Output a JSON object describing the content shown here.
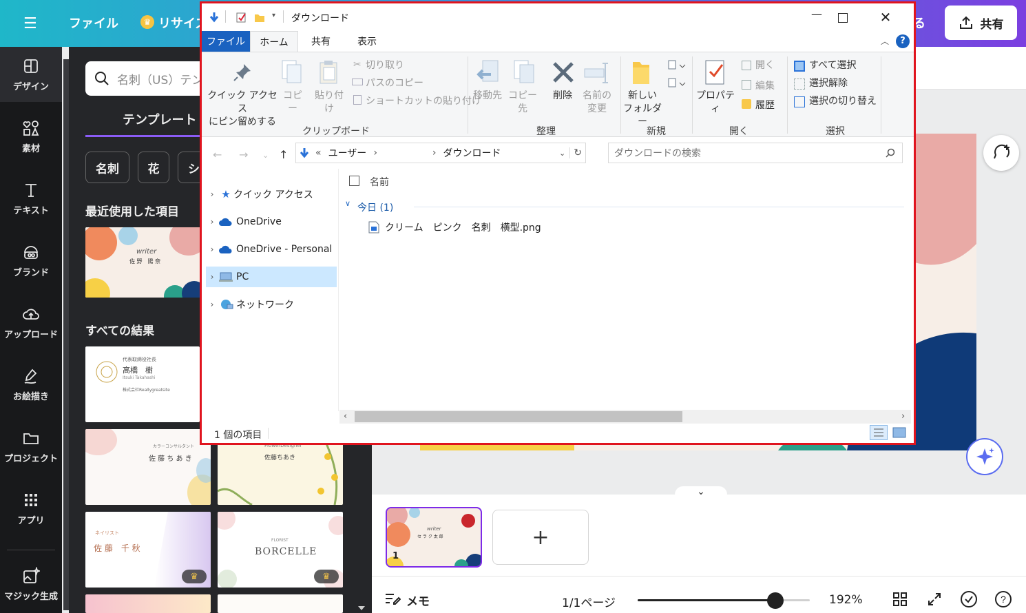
{
  "header": {
    "file_menu": "ファイル",
    "resize": "リサイズ",
    "share": "共有",
    "partial_right": "る"
  },
  "rail": {
    "items": [
      {
        "label": "デザイン"
      },
      {
        "label": "素材"
      },
      {
        "label": "テキスト"
      },
      {
        "label": "ブランド"
      },
      {
        "label": "アップロード"
      },
      {
        "label": "お絵描き"
      },
      {
        "label": "プロジェクト"
      },
      {
        "label": "アプリ"
      },
      {
        "label": "マジック生成"
      }
    ]
  },
  "panel": {
    "search_placeholder": "名刺（US）テン",
    "template_tab": "テンプレート",
    "chips": [
      "名刺",
      "花",
      "シ"
    ],
    "recent_title": "最近使用した項目",
    "all_results_title": "すべての結果",
    "cards": [
      {
        "name": "高橋　樹",
        "sub": "Itsuki Takahashi",
        "company": "株式会社Reallygreatsite",
        "role": "代表取締役社長"
      },
      {
        "name": "佐 藤 ち あ き",
        "role": "カラーコンサルタント"
      },
      {
        "name": "佐藤ちあき",
        "role": "FlowerDesigner"
      },
      {
        "name": "佐 藤　千 秋",
        "role": "ネイリスト"
      },
      {
        "name": "BORCELLE",
        "role": "FLORIST"
      }
    ],
    "recent_card": {
      "script": "writer",
      "name": "佐 野　陽 奈"
    },
    "crown": "♛"
  },
  "editor": {
    "page_label": "1",
    "add_page": "+",
    "memo": "メモ",
    "page_indicator": "1/1ページ",
    "zoom": "192%",
    "zoom_fraction": 0.8,
    "thumb_script": "writer",
    "thumb_name": "セ ラ ク 太 郎"
  },
  "explorer": {
    "title": "ダウンロード",
    "tabs": {
      "file": "ファイル",
      "home": "ホーム",
      "share": "共有",
      "view": "表示"
    },
    "ribbon": {
      "pin": "クイック アクセス\nにピン留めする",
      "copy": "コピー",
      "paste": "貼り付け",
      "cut": "切り取り",
      "copy_path": "パスのコピー",
      "paste_shortcut": "ショートカットの貼り付け",
      "clipboard": "クリップボード",
      "move_to": "移動先",
      "copy_to": "コピー先",
      "delete": "削除",
      "rename": "名前の\n変更",
      "organize": "整理",
      "new_folder": "新しい\nフォルダー",
      "new": "新規",
      "properties": "プロパティ",
      "open": "開く",
      "edit": "編集",
      "history": "履歴",
      "open_group": "開く",
      "select_all": "すべて選択",
      "select_none": "選択解除",
      "invert": "選択の切り替え",
      "select": "選択"
    },
    "address": {
      "prefix": "«",
      "seg1": "ユーザー",
      "seg2": "ダウンロード"
    },
    "search_placeholder": "ダウンロードの検索",
    "nav": [
      {
        "label": "クイック アクセス",
        "icon": "quick-access-star-icon"
      },
      {
        "label": "OneDrive",
        "icon": "onedrive-cloud-icon"
      },
      {
        "label": "OneDrive - Personal",
        "icon": "onedrive-cloud-icon"
      },
      {
        "label": "PC",
        "icon": "pc-icon"
      },
      {
        "label": "ネットワーク",
        "icon": "network-icon"
      }
    ],
    "column_name": "名前",
    "group_header": "今日 (1)",
    "files": [
      {
        "name": "クリーム　ピンク　名刺　横型.png"
      }
    ],
    "status": "1 個の項目"
  }
}
